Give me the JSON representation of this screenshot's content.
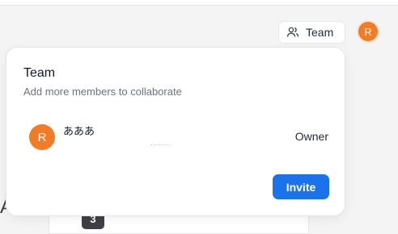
{
  "header": {
    "team_button_label": "Team",
    "avatar_initial": "R"
  },
  "background": {
    "partial_letter": "A",
    "badge_number": "3"
  },
  "team_popover": {
    "title": "Team",
    "subtitle": "Add more members to collaborate",
    "members": [
      {
        "initial": "R",
        "name": "あああ",
        "role": "Owner"
      }
    ],
    "invite_label": "Invite"
  },
  "colors": {
    "accent": "#1a73e8",
    "avatar": "#f07c28"
  }
}
